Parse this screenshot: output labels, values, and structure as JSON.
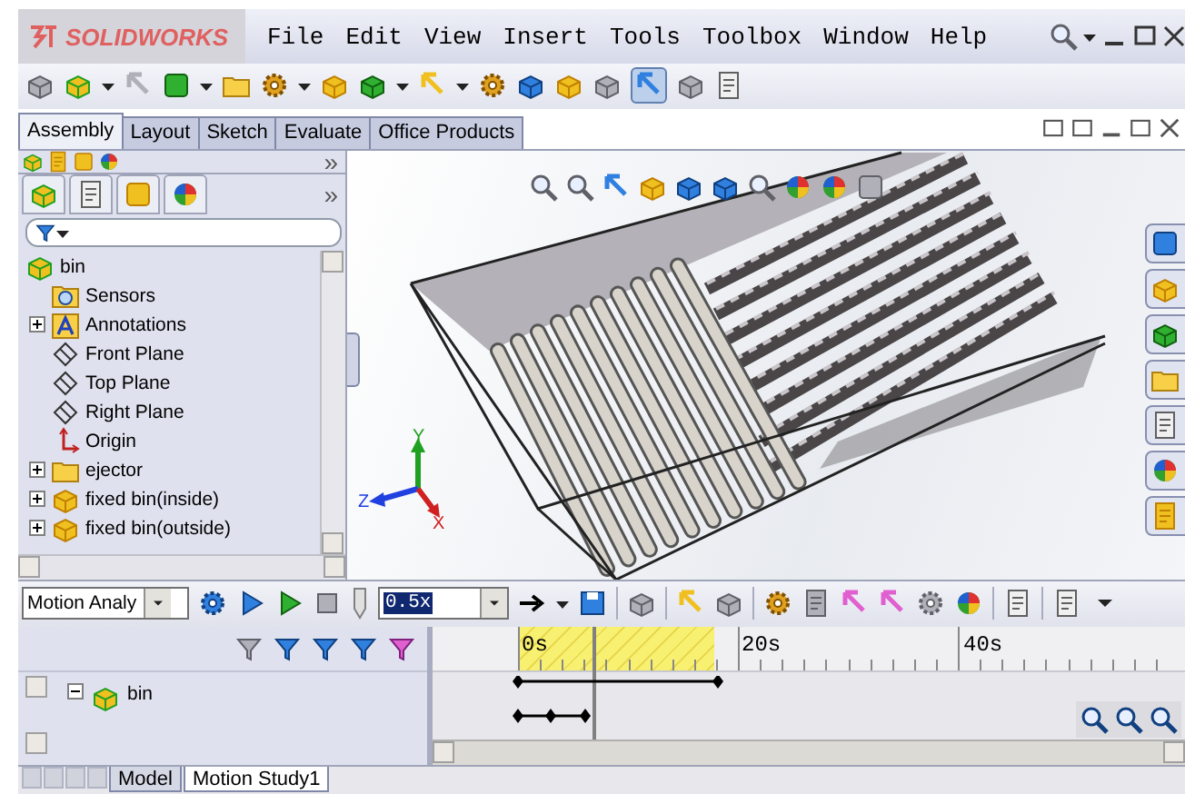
{
  "app": {
    "logo": "SOLIDWORKS"
  },
  "menu": [
    "File",
    "Edit",
    "View",
    "Insert",
    "Tools",
    "Toolbox",
    "Window",
    "Help"
  ],
  "ribbon_tabs": [
    {
      "label": "Assembly",
      "selected": true
    },
    {
      "label": "Layout",
      "selected": false
    },
    {
      "label": "Sketch",
      "selected": false
    },
    {
      "label": "Evaluate",
      "selected": false
    },
    {
      "label": "Office Products",
      "selected": false
    }
  ],
  "panel_chevrons": [
    "»",
    "»"
  ],
  "feature_tree": {
    "label": "bin",
    "kind": "assembly",
    "children": [
      {
        "label": "Sensors",
        "kind": "sensors",
        "expandable": false
      },
      {
        "label": "Annotations",
        "kind": "annotations",
        "expandable": true,
        "expanded": false
      },
      {
        "label": "Front Plane",
        "kind": "plane",
        "expandable": false
      },
      {
        "label": "Top Plane",
        "kind": "plane",
        "expandable": false
      },
      {
        "label": "Right Plane",
        "kind": "plane",
        "expandable": false
      },
      {
        "label": "Origin",
        "kind": "origin",
        "expandable": false
      },
      {
        "label": "ejector",
        "kind": "folder",
        "expandable": true,
        "expanded": false
      },
      {
        "label": "fixed bin(inside)",
        "kind": "part",
        "expandable": true,
        "expanded": false
      },
      {
        "label": "fixed bin(outside)",
        "kind": "part",
        "expandable": true,
        "expanded": false
      }
    ]
  },
  "viewport": {
    "triad": [
      "Y",
      "Z",
      "X"
    ]
  },
  "motion_toolbar": {
    "study_type": "Motion Analy",
    "playback_speed": "0.5x"
  },
  "timeline": {
    "ruler": [
      "0s",
      "20s",
      "40s"
    ],
    "tree": {
      "label": "bin",
      "expanded": true
    }
  },
  "bottom_tabs": [
    {
      "label": "Model",
      "selected": false
    },
    {
      "label": "Motion Study1",
      "selected": true
    }
  ]
}
